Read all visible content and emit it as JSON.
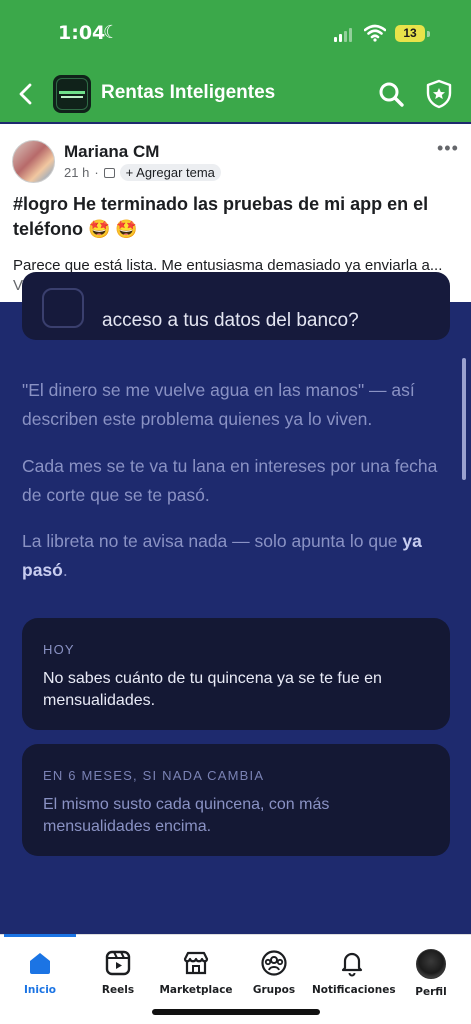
{
  "status_bar": {
    "time": "1:04",
    "battery": "13"
  },
  "header": {
    "group_name": "Rentas Inteligentes",
    "colors": {
      "bar": "#3ba84a"
    }
  },
  "post": {
    "author": "Mariana CM",
    "time_ago": "21 h",
    "separator": "·",
    "add_topic_label": "+ Agregar tema",
    "title": "#logro He terminado las pruebas de mi app en el teléfono 🤩 🤩",
    "body_text": "Parece que está lista. Me entusiasma demasiado ya enviarla a...",
    "see_more": "Ver más"
  },
  "image_content": {
    "top_card_text": "acceso a tus datos del banco?",
    "paragraph_1": "\"El dinero se me vuelve agua en las manos\" — así describen este problema quienes ya lo viven.",
    "paragraph_2": "Cada mes se te va tu lana en intereses por una fecha de corte que se te pasó.",
    "paragraph_3_start": "La libreta no te avisa nada — solo apunta lo que ",
    "paragraph_3_bold": "ya pasó",
    "paragraph_3_end": ".",
    "card_today": {
      "label": "HOY",
      "text": "No sabes cuánto de tu quincena ya se te fue en mensualidades."
    },
    "card_future": {
      "label": "EN 6 MESES, SI NADA CAMBIA",
      "text": "El mismo susto cada quincena, con más mensualidades encima."
    }
  },
  "tabbar": {
    "tabs": [
      {
        "label": "Inicio",
        "icon": "home-icon",
        "active": true
      },
      {
        "label": "Reels",
        "icon": "reels-icon"
      },
      {
        "label": "Marketplace",
        "icon": "marketplace-icon"
      },
      {
        "label": "Grupos",
        "icon": "groups-icon"
      },
      {
        "label": "Notificaciones",
        "icon": "bell-icon"
      },
      {
        "label": "Perfil",
        "icon": "profile-avatar"
      }
    ],
    "colors": {
      "active": "#1b74e4"
    }
  }
}
